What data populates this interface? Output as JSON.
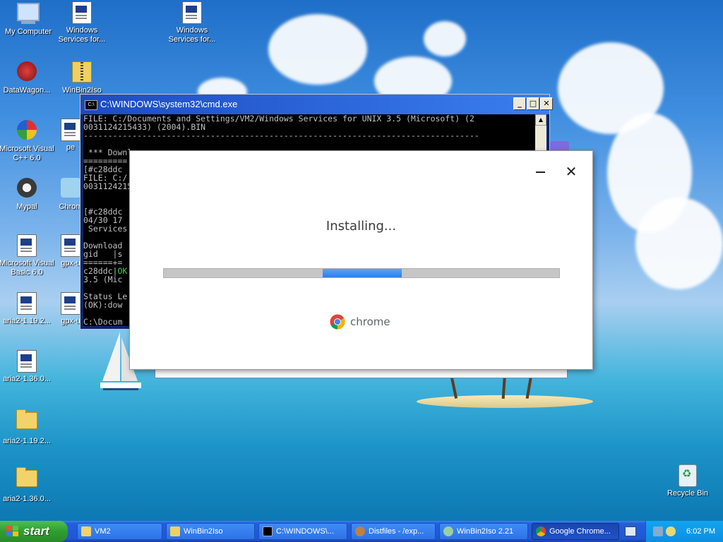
{
  "desktop": {
    "icons": [
      {
        "label": "My Computer",
        "icon": "computer-icon"
      },
      {
        "label": "Windows\nServices for...",
        "icon": "document-icon"
      },
      {
        "label": "Windows\nServices for...",
        "icon": "document-icon"
      },
      {
        "label": "DataWagon...",
        "icon": "datawagon-icon"
      },
      {
        "label": "WinBin2Iso",
        "icon": "zip-icon"
      },
      {
        "label": "Microsoft Visual\nC++ 6.0",
        "icon": "visual-cpp-icon"
      },
      {
        "label": "pe",
        "icon": "document-icon"
      },
      {
        "label": "Mypal",
        "icon": "mypal-icon"
      },
      {
        "label": "Chrom",
        "icon": "chrome-installer-icon"
      },
      {
        "label": "Microsoft Visual\nBasic 6.0",
        "icon": "visual-basic-icon"
      },
      {
        "label": "gpx-u",
        "icon": "document-icon"
      },
      {
        "label": "aria2-1.19.2...",
        "icon": "document-icon"
      },
      {
        "label": "gpx-u",
        "icon": "document-icon"
      },
      {
        "label": "aria2-1.36.0...",
        "icon": "document-icon"
      },
      {
        "label": "aria2-1.19.2...",
        "icon": "folder-icon"
      },
      {
        "label": "aria2-1.36.0...",
        "icon": "folder-icon"
      },
      {
        "label": "Recycle Bin",
        "icon": "recycle-bin-icon"
      }
    ]
  },
  "cmd": {
    "title": "C:\\WINDOWS\\system32\\cmd.exe",
    "lines": [
      "FILE: C:/Documents and Settings/VM2/Windows Services for UNIX 3.5 (Microsoft) (2",
      "0031124215433) (2004).BIN",
      "---------------------------------------------------------------------------------",
      "",
      " *** Downl",
      "=========",
      "[#c28ddc",
      "FILE: C:/",
      "0031124215",
      "",
      "",
      "[#c28ddc",
      "04/30 17",
      " Services",
      "",
      "Download",
      "gid   |s",
      "======+=",
      "c28ddc|OK",
      "3.5 (Mic",
      "",
      "Status Le",
      "(OK):dow",
      "",
      "C:\\Docum"
    ]
  },
  "installer": {
    "status": "Installing...",
    "progress_fraction": 0.2,
    "brand": "chrome",
    "minimize_symbol": "—",
    "close_symbol": "✕"
  },
  "taskbar": {
    "start_label": "start",
    "tasks": [
      {
        "label": "VM2",
        "icon": "folder-icon"
      },
      {
        "label": "WinBin2Iso",
        "icon": "zip-icon"
      },
      {
        "label": "C:\\WINDOWS\\...",
        "icon": "cmd-icon"
      },
      {
        "label": "Distfiles - /exp...",
        "icon": "browser-icon"
      },
      {
        "label": "WinBin2Iso 2.21",
        "icon": "disc-icon"
      },
      {
        "label": "Google Chrome...",
        "icon": "chrome-icon"
      }
    ],
    "clock": "6:02 PM"
  },
  "colors": {
    "xp_blue": "#245edb",
    "start_green": "#2f9e2f",
    "progress_blue": "#2c7fe6",
    "progress_track": "#c6c6c6"
  }
}
